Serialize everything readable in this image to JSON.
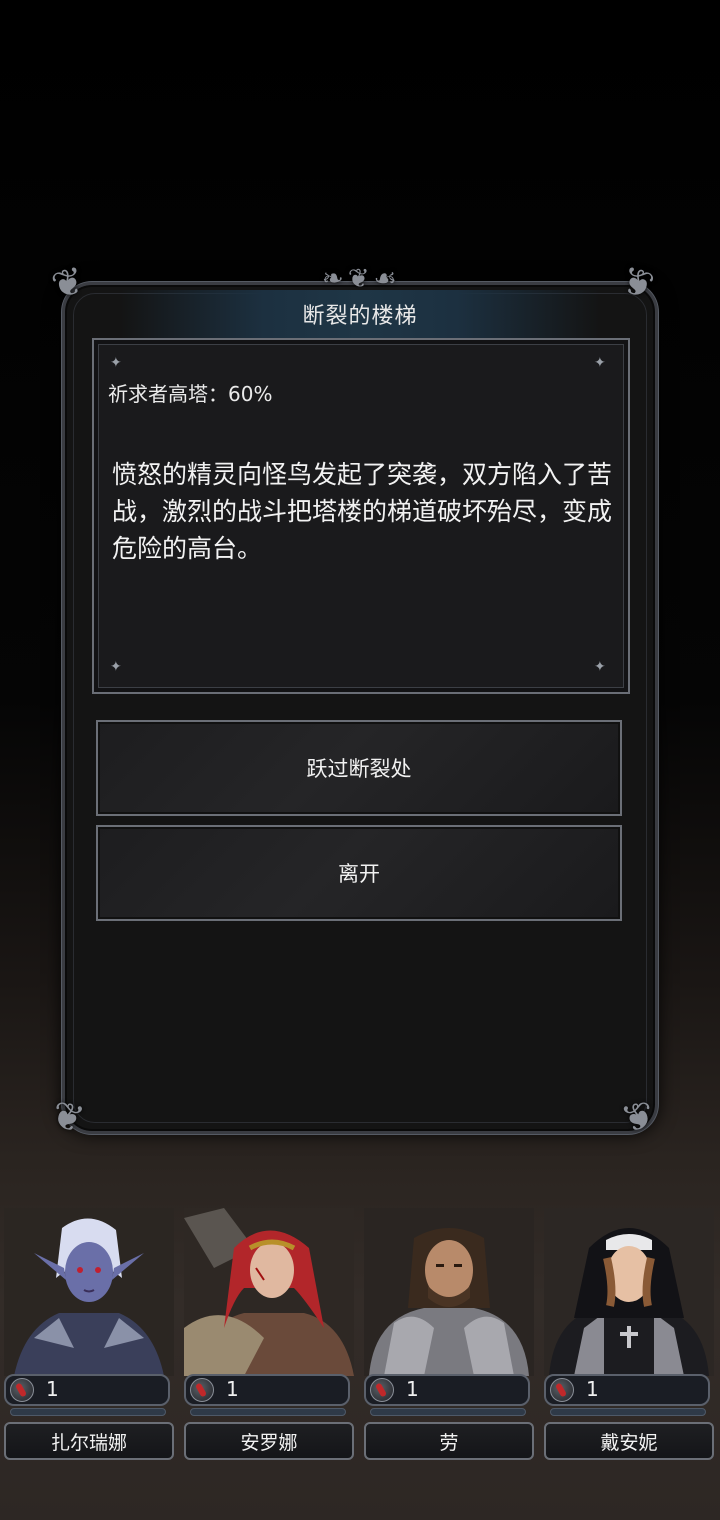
{
  "event": {
    "title": "断裂的楼梯",
    "requirement": "祈求者高塔：60%",
    "story": "愤怒的精灵向怪鸟发起了突袭，双方陷入了苦战，激烈的战斗把塔楼的梯道破坏殆尽，变成危险的高台。",
    "choices": [
      {
        "label": "跃过断裂处"
      },
      {
        "label": "离开"
      }
    ]
  },
  "party": [
    {
      "name": "扎尔瑞娜",
      "hp": "1",
      "icon": "blood-drop-icon"
    },
    {
      "name": "安罗娜",
      "hp": "1",
      "icon": "blood-drop-icon"
    },
    {
      "name": "劳",
      "hp": "1",
      "icon": "blood-drop-icon"
    },
    {
      "name": "戴安妮",
      "hp": "1",
      "icon": "blood-drop-icon"
    }
  ]
}
